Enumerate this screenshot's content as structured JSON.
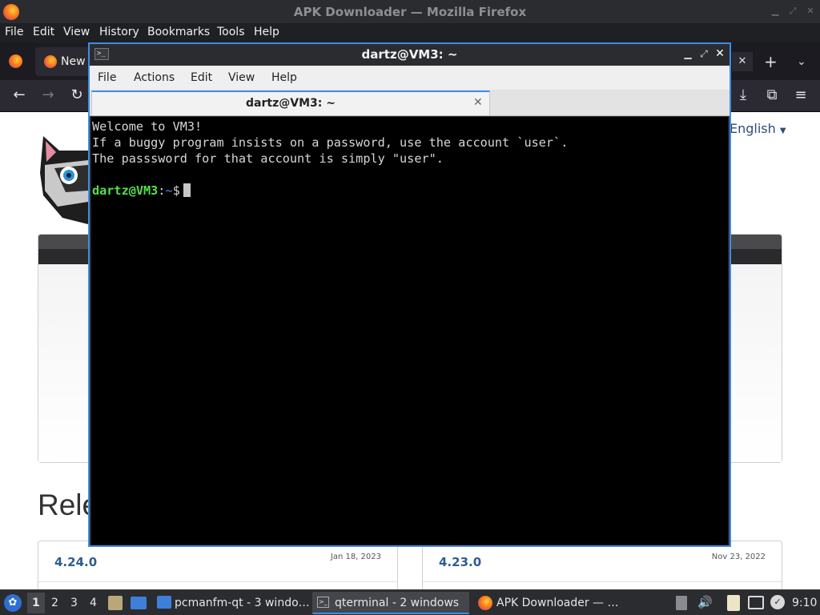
{
  "firefox": {
    "window_title": "APK Downloader — Mozilla Firefox",
    "menu": [
      "File",
      "Edit",
      "View",
      "History",
      "Bookmarks",
      "Tools",
      "Help"
    ],
    "tab_label": "New",
    "page": {
      "language": "English",
      "heading_partial": "Rele",
      "releases": [
        {
          "version": "4.24.0",
          "date": "Jan 18, 2023"
        },
        {
          "version": "4.23.0",
          "date": "Nov 23, 2022"
        }
      ]
    }
  },
  "terminal": {
    "title": "dartz@VM3: ~",
    "menu": [
      "File",
      "Actions",
      "Edit",
      "View",
      "Help"
    ],
    "tab_label": "dartz@VM3: ~",
    "lines": [
      "Welcome to VM3!",
      "If a buggy program insists on a password, use the account `user`.",
      "The passsword for that account is simply \"user\"."
    ],
    "prompt_user": "dartz@VM3",
    "prompt_sep": ":",
    "prompt_path": "~",
    "prompt_symbol": "$"
  },
  "taskbar": {
    "workspaces": [
      "1",
      "2",
      "3",
      "4"
    ],
    "tasks": [
      {
        "label": "pcmanfm-qt - 3 windo…"
      },
      {
        "label": "qterminal - 2 windows"
      },
      {
        "label": "APK Downloader — …"
      }
    ],
    "clock": "9:10"
  },
  "colors": {
    "accent": "#3d8ee6",
    "prompt_green": "#55e04a",
    "prompt_blue": "#4f8ef2",
    "link_blue": "#2e5c92"
  }
}
